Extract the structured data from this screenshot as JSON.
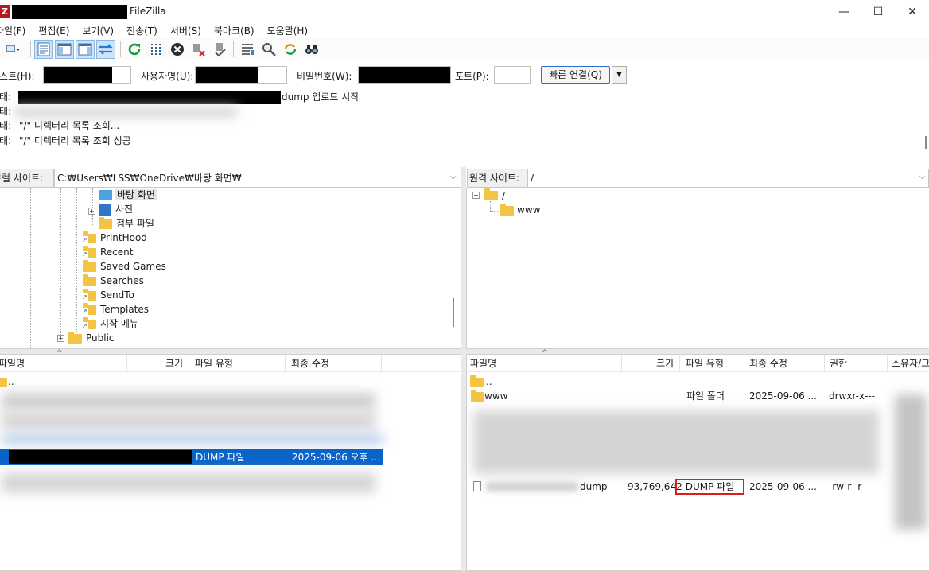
{
  "window": {
    "title": "FileZilla",
    "controls": {
      "minimize": "—",
      "maximize": "☐",
      "close": "✕"
    }
  },
  "menu": [
    "파일(F)",
    "편집(E)",
    "보기(V)",
    "전송(T)",
    "서버(S)",
    "북마크(B)",
    "도움말(H)"
  ],
  "quickconnect": {
    "host_label": "호스트(H):",
    "user_label": "사용자명(U):",
    "pass_label": "비밀번호(W):",
    "port_label": "포트(P):",
    "port_value": "",
    "button_label": "빠른 연결(Q)"
  },
  "log": [
    {
      "prefix": "상태:",
      "text": "dump 업로드 시작"
    },
    {
      "prefix": "상태:",
      "text": ""
    },
    {
      "prefix": "상태:",
      "text": "\"/\" 디렉터리 목록 조회..."
    },
    {
      "prefix": "상태:",
      "text": "\"/\" 디렉터리 목록 조회 성공"
    }
  ],
  "local": {
    "label": "로컬 사이트:",
    "path": "C:₩Users₩LSS₩OneDrive₩바탕 화면₩",
    "tree": [
      "바탕 화면",
      "사진",
      "첨부 파일",
      "PrintHood",
      "Recent",
      "Saved Games",
      "Searches",
      "SendTo",
      "Templates",
      "시작 메뉴",
      "Public"
    ],
    "columns": [
      "파일명",
      "크기",
      "파일 유형",
      "최종 수정"
    ],
    "parent_row": "..",
    "selected_file": {
      "type": "DUMP 파일",
      "modified": "2025-09-06 오후 ..."
    }
  },
  "remote": {
    "label": "원격 사이트:",
    "path": "/",
    "tree": [
      "/",
      "www"
    ],
    "columns": [
      "파일명",
      "크기",
      "파일 유형",
      "최종 수정",
      "권한",
      "소유자/그룹"
    ],
    "parent_row": "..",
    "rows": [
      {
        "name": "www",
        "size": "",
        "type": "파일 폴더",
        "modified": "2025-09-06 ...",
        "perm": "drwxr-x---"
      },
      {
        "name": "dump",
        "size": "93,769,642",
        "type": "DUMP 파일",
        "modified": "2025-09-06 ...",
        "perm": "-rw-r--r--"
      }
    ]
  },
  "colors": {
    "selection": "#0a64c8",
    "highlight_box": "#e01b1b",
    "folder": "#f5c342"
  }
}
